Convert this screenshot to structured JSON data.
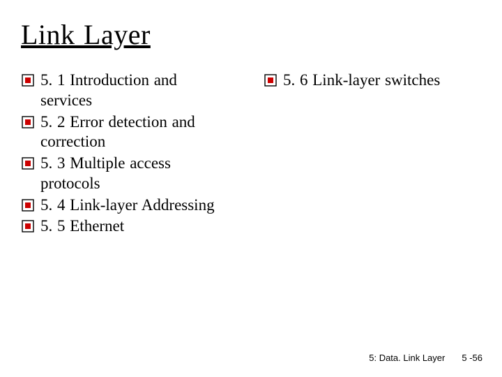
{
  "title": "Link Layer",
  "left_items": [
    "5. 1 Introduction and services",
    "5. 2 Error detection and correction",
    "5. 3 Multiple access protocols",
    "5. 4 Link-layer Addressing",
    "5. 5 Ethernet"
  ],
  "right_items": [
    "5. 6 Link-layer switches"
  ],
  "footer": {
    "section": "5: Data. Link Layer",
    "page": "5 -56"
  }
}
